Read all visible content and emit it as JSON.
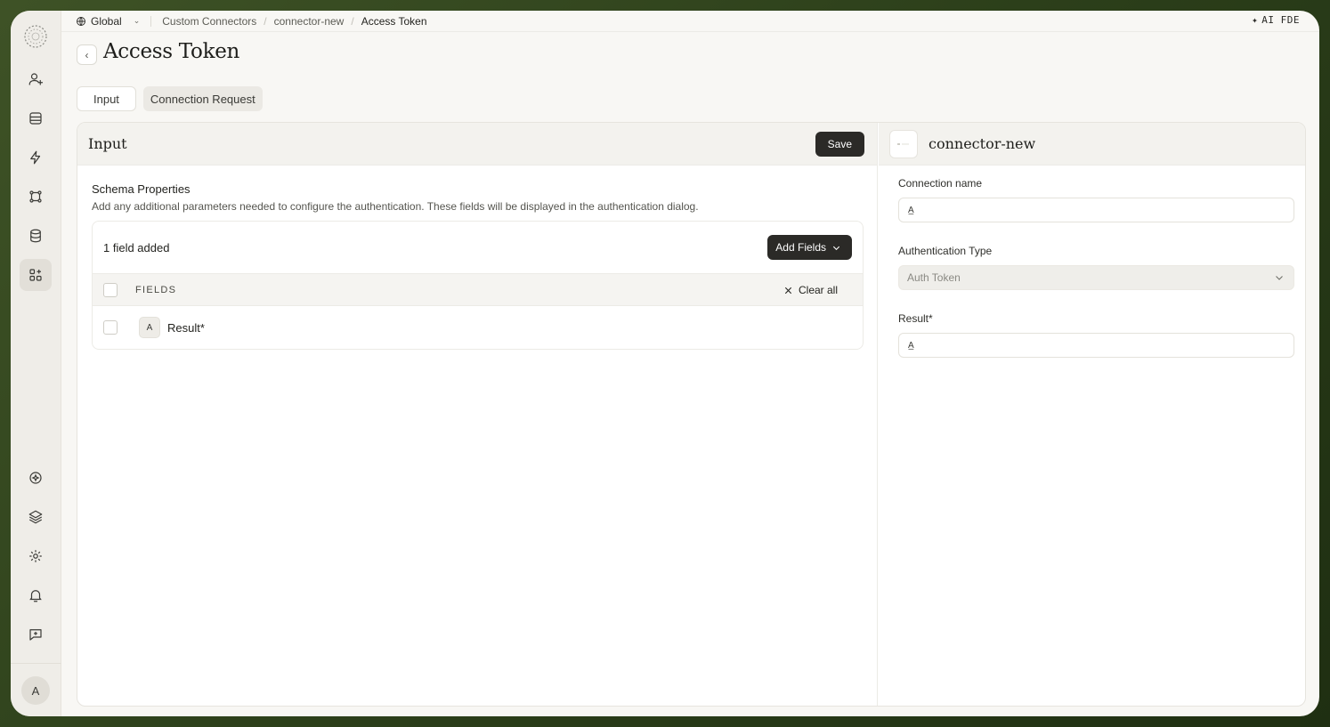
{
  "topbar": {
    "scope": "Global",
    "breadcrumbs": [
      "Custom Connectors",
      "connector-new",
      "Access Token"
    ],
    "ai_label": "AI FDE"
  },
  "page": {
    "title": "Access Token"
  },
  "tabs": [
    {
      "label": "Input"
    },
    {
      "label": "Connection Request"
    }
  ],
  "left": {
    "title": "Input",
    "save_label": "Save",
    "schema_title": "Schema Properties",
    "schema_desc": "Add any additional parameters needed to configure the authentication. These fields will be displayed in the authentication dialog.",
    "field_count": "1 field added",
    "add_fields_label": "Add Fields",
    "columns_label": "FIELDS",
    "clear_all_label": "Clear all",
    "rows": [
      {
        "icon_glyph": "A",
        "name": "Result*"
      }
    ]
  },
  "right": {
    "connector_name": "connector-new",
    "connection_name_label": "Connection name",
    "connection_name_value": "",
    "auth_type_label": "Authentication Type",
    "auth_type_value": "Auth Token",
    "result_label": "Result*",
    "result_value": ""
  },
  "sidebar": {
    "avatar_initial": "A",
    "icons": [
      "user-plus-icon",
      "inbox-icon",
      "lightning-icon",
      "workflow-icon",
      "database-icon",
      "apps-icon",
      "shield-icon",
      "layers-icon",
      "settings-icon",
      "bell-icon",
      "feedback-icon"
    ]
  }
}
